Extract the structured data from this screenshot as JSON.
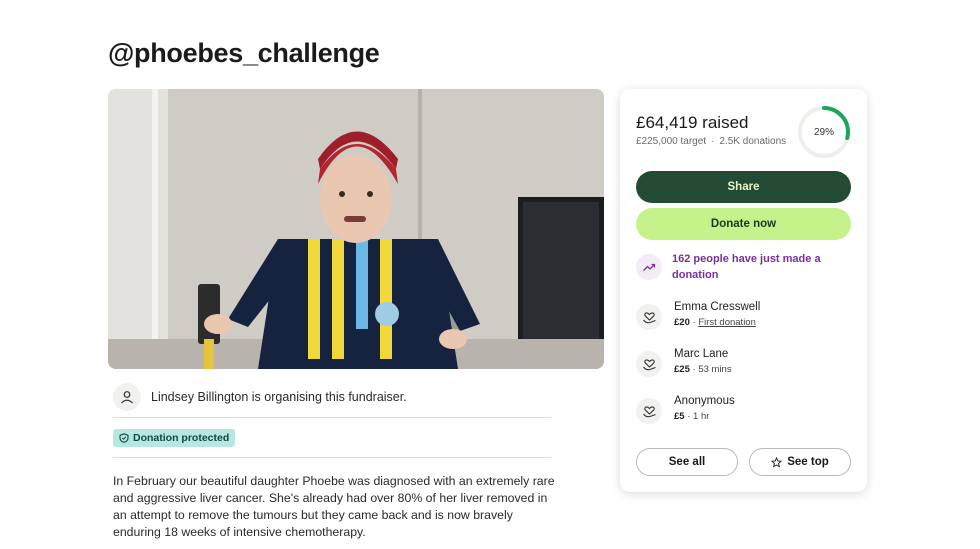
{
  "page": {
    "title": "@phoebes_challenge"
  },
  "organiser": {
    "text": "Lindsey Billington is organising this fundraiser."
  },
  "badge": {
    "label": "Donation protected"
  },
  "story": {
    "text": "In February our beautiful daughter Phoebe was diagnosed with an extremely rare and aggressive liver cancer. She's already had over 80% of her liver removed in an attempt to remove the tumours but they came back and is now bravely enduring 18 weeks of intensive chemotherapy."
  },
  "card": {
    "raised": "£64,419 raised",
    "target": "£225,000 target",
    "donations_count": "2.5K donations",
    "progress_label": "29%",
    "progress_value": 0.29,
    "share_label": "Share",
    "donate_label": "Donate now",
    "trend_text": "162 people have just made a donation",
    "donations": [
      {
        "name": "Emma Cresswell",
        "amount": "£20",
        "meta": "First donation"
      },
      {
        "name": "Marc Lane",
        "amount": "£25",
        "meta": "53 mins"
      },
      {
        "name": "Anonymous",
        "amount": "£5",
        "meta": "1 hr"
      }
    ],
    "see_all_label": "See all",
    "see_top_label": "See top"
  },
  "colors": {
    "share_bg": "#234a33",
    "donate_bg": "#c6f28b",
    "progress_green": "#1ea55a",
    "trend_purple": "#7a2f9b",
    "badge_bg": "#b8e7e1"
  },
  "icons": {
    "organiser": "user-icon",
    "badge": "shield-icon",
    "trend": "trending-up-icon",
    "donation": "heart-hand-icon",
    "see_top": "star-icon"
  }
}
